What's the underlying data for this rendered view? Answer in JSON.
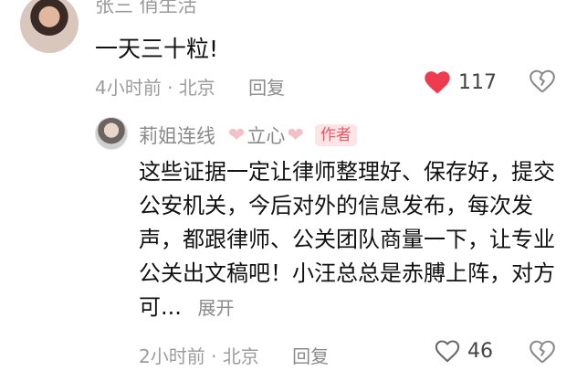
{
  "top_comment": {
    "username": "张三 俏生活",
    "text": "一天三十粒!",
    "time": "4小时前",
    "location": "北京",
    "reply_label": "回复",
    "like_count": "117",
    "liked": true,
    "like_color": "#ef3b50"
  },
  "reply_comment": {
    "username": "莉姐连线",
    "name_suffix": "立心",
    "author_badge": "作者",
    "body": "这些证据一定让律师整理好、保存好，提交公安机关，今后对外的信息发布，每次发声，都跟律师、公关团队商量一下，让专业公关出文稿吧！小汪总总是赤膊上阵，对方可...",
    "expand_label": "展开",
    "time": "2小时前",
    "location": "北京",
    "reply_label": "回复",
    "like_count": "46",
    "liked": false,
    "badge_color": "#ee5564"
  }
}
